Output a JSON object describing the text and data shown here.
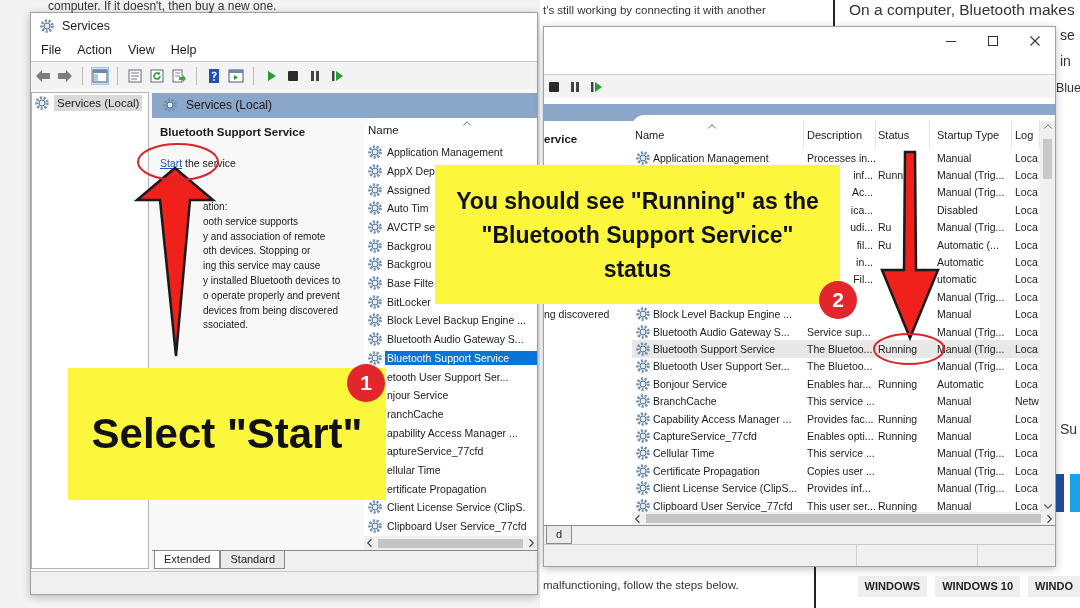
{
  "left_screenshot": {
    "page_text": "computer. If it doesn't, then buy a new one.",
    "window": {
      "title": "Services",
      "menu": [
        "File",
        "Action",
        "View",
        "Help"
      ],
      "tree": [
        {
          "label": "Services (Local)",
          "selected": true
        }
      ],
      "pane_title": "Services (Local)",
      "service_title": "Bluetooth Support Service",
      "action": {
        "link": "Start",
        "rest": "the service"
      },
      "description_lines": [
        "ation:",
        "ooth service supports",
        "y and association of remote",
        "oth devices.  Stopping or",
        "ing this service may cause",
        "y installed Bluetooth devices to",
        "o operate properly and prevent",
        "devices from being discovered",
        "ssociated."
      ],
      "list_header": "Name",
      "services": [
        {
          "name": "Application Management",
          "icon": true,
          "selected": false
        },
        {
          "name": "AppX Dep",
          "icon": true,
          "selected": false
        },
        {
          "name": "Assigned",
          "icon": true,
          "selected": false
        },
        {
          "name": "Auto Tim",
          "icon": true,
          "selected": false
        },
        {
          "name": "AVCTP se",
          "icon": true,
          "selected": false
        },
        {
          "name": "Backgrou",
          "icon": true,
          "selected": false
        },
        {
          "name": "Backgrou",
          "icon": true,
          "selected": false
        },
        {
          "name": "Base Filte",
          "icon": true,
          "selected": false
        },
        {
          "name": "BitLocker",
          "icon": true,
          "selected": false
        },
        {
          "name": "Block Level Backup Engine ...",
          "icon": true,
          "selected": false
        },
        {
          "name": "Bluetooth Audio Gateway S...",
          "icon": true,
          "selected": false
        },
        {
          "name": "Bluetooth Support Service",
          "icon": true,
          "selected": true
        },
        {
          "name": "etooth User Support Ser...",
          "selected": false
        },
        {
          "name": "njour Service",
          "selected": false
        },
        {
          "name": "ranchCache",
          "selected": false
        },
        {
          "name": "apability Access Manager ...",
          "selected": false
        },
        {
          "name": "aptureService_77cfd",
          "selected": false
        },
        {
          "name": "ellular Time",
          "selected": false
        },
        {
          "name": "ertificate Propagation",
          "selected": false
        },
        {
          "name": "Client License Service (ClipS.",
          "icon": true,
          "selected": false
        },
        {
          "name": "Clipboard User Service_77cfd",
          "icon": true,
          "selected": false
        }
      ],
      "view_tabs": [
        {
          "label": "Extended",
          "selected": true
        },
        {
          "label": "Standard",
          "selected": false
        }
      ]
    }
  },
  "right_screenshot": {
    "page_text_top": "t's still working by connecting it with another",
    "heading_text": "On a computer, Bluetooth makes",
    "side_fragments": [
      "se",
      "in",
      "Blue",
      "Su"
    ],
    "window": {
      "service_title": "ervice",
      "description_tail": "ng discovered",
      "columns": [
        "Name",
        "Description",
        "Status",
        "Startup Type",
        "Log"
      ],
      "rows": [
        {
          "name": "Application Management",
          "icon": true,
          "description": "Processes in...",
          "startup_type": "Manual",
          "log": "Loca",
          "selected": false
        },
        {
          "description": "inf...",
          "status": "Runn",
          "startup_type": "Manual (Trig...",
          "log": "Loca",
          "selected": false
        },
        {
          "description": "Ac...",
          "startup_type": "Manual (Trig...",
          "log": "Loca",
          "selected": false
        },
        {
          "description": "ica...",
          "startup_type": "Disabled",
          "log": "Loca",
          "selected": false
        },
        {
          "description": "udi...",
          "status": "Ru",
          "startup_type": "Manual (Trig...",
          "log": "Loca",
          "selected": false
        },
        {
          "description": "fil...",
          "status": "Ru",
          "startup_type": "Automatic (...",
          "log": "Loca",
          "selected": false
        },
        {
          "description": "in...",
          "startup_type": "Automatic",
          "log": "Loca",
          "selected": false
        },
        {
          "description": "Fil...",
          "startup_type": "utomatic",
          "log": "Loca",
          "selected": false
        },
        {
          "startup_type": "Manual (Trig...",
          "log": "Loca",
          "selected": false
        },
        {
          "name": "Block Level Backup Engine ...",
          "icon": true,
          "startup_type": "Manual",
          "log": "Loca",
          "selected": false
        },
        {
          "name": "Bluetooth Audio Gateway S...",
          "icon": true,
          "description": "Service sup...",
          "startup_type": "Manual (Trig...",
          "log": "Loca",
          "selected": false
        },
        {
          "name": "Bluetooth Support Service",
          "icon": true,
          "description": "The Bluetoo...",
          "status": "Running",
          "startup_type": "Manual (Trig...",
          "log": "Loca",
          "selected": true
        },
        {
          "name": "Bluetooth User Support Ser...",
          "icon": true,
          "description": "The Bluetoo...",
          "startup_type": "Manual (Trig...",
          "log": "Loca",
          "selected": false
        },
        {
          "name": "Bonjour Service",
          "icon": true,
          "description": "Enables har...",
          "status": "Running",
          "startup_type": "Automatic",
          "log": "Loca",
          "selected": false
        },
        {
          "name": "BranchCache",
          "icon": true,
          "description": "This service ...",
          "startup_type": "Manual",
          "log": "Netw",
          "selected": false
        },
        {
          "name": "Capability Access Manager ...",
          "icon": true,
          "description": "Provides fac...",
          "status": "Running",
          "startup_type": "Manual",
          "log": "Loca",
          "selected": false
        },
        {
          "name": "CaptureService_77cfd",
          "icon": true,
          "description": "Enables opti...",
          "status": "Running",
          "startup_type": "Manual",
          "log": "Loca",
          "selected": false
        },
        {
          "name": "Cellular Time",
          "icon": true,
          "description": "This service ...",
          "startup_type": "Manual (Trig...",
          "log": "Loca",
          "selected": false
        },
        {
          "name": "Certificate Propagation",
          "icon": true,
          "description": "Copies user ...",
          "startup_type": "Manual (Trig...",
          "log": "Loca",
          "selected": false
        },
        {
          "name": "Client License Service (ClipS...",
          "icon": true,
          "description": "Provides inf...",
          "startup_type": "Manual (Trig...",
          "log": "Loca",
          "selected": false
        },
        {
          "name": "Clipboard User Service_77cfd",
          "icon": true,
          "description": "This user ser...",
          "status": "Running",
          "startup_type": "Manual",
          "log": "Loca",
          "selected": false
        }
      ],
      "view_tabs": [
        {
          "label": "d",
          "selected": false
        }
      ]
    },
    "bottom_text": "malfunctioning, follow the steps below.",
    "tags": [
      "WINDOWS",
      "WINDOWS 10",
      "WINDO"
    ]
  },
  "callouts": [
    {
      "text": "Select \"Start\""
    },
    {
      "text": "You should see \"Running\" as the \"Bluetooth Support Service\" status"
    }
  ],
  "step_badges": [
    "1",
    "2"
  ]
}
